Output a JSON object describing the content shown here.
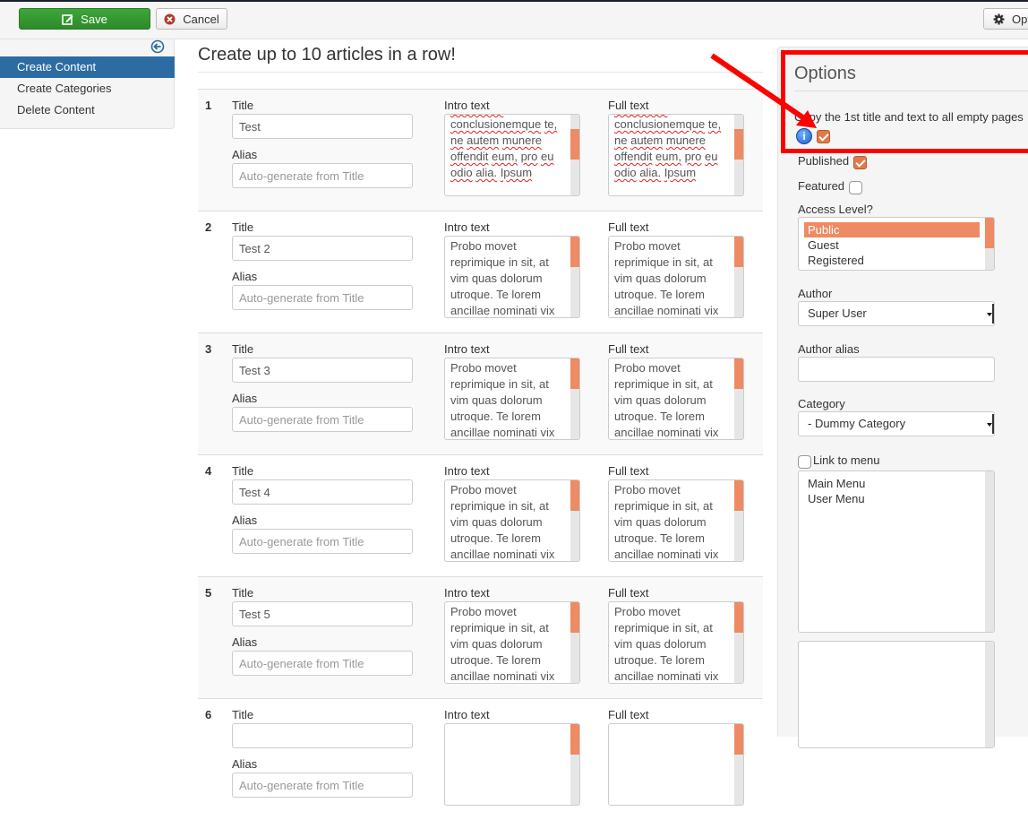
{
  "toolbar": {
    "save_label": "Save",
    "cancel_label": "Cancel",
    "options_label": "Options"
  },
  "sidebar": {
    "items": [
      {
        "label": "Create Content",
        "active": true
      },
      {
        "label": "Create Categories",
        "active": false
      },
      {
        "label": "Delete Content",
        "active": false
      }
    ]
  },
  "main": {
    "title": "Create up to 10 articles in a row!",
    "labels": {
      "title": "Title",
      "alias": "Alias",
      "intro": "Intro text",
      "full": "Full text",
      "alias_placeholder": "Auto-generate from Title"
    },
    "articles": [
      {
        "num": "1",
        "title": "Test",
        "intro": "definiebas conclusionemque te, ne autem munere offendit eum, pro eu odio alia. Ipsum",
        "full": "definiebas conclusionemque te, ne autem munere offendit eum, pro eu odio alia. Ipsum"
      },
      {
        "num": "2",
        "title": "Test 2",
        "intro": "Probo movet reprimique in sit, at vim quas dolorum utroque. Te lorem ancillae nominati vix",
        "full": "Probo movet reprimique in sit, at vim quas dolorum utroque. Te lorem ancillae nominati vix"
      },
      {
        "num": "3",
        "title": "Test 3",
        "intro": "Probo movet reprimique in sit, at vim quas dolorum utroque. Te lorem ancillae nominati vix",
        "full": "Probo movet reprimique in sit, at vim quas dolorum utroque. Te lorem ancillae nominati vix"
      },
      {
        "num": "4",
        "title": "Test 4",
        "intro": "Probo movet reprimique in sit, at vim quas dolorum utroque. Te lorem ancillae nominati vix",
        "full": "Probo movet reprimique in sit, at vim quas dolorum utroque. Te lorem ancillae nominati vix"
      },
      {
        "num": "5",
        "title": "Test 5",
        "intro": "Probo movet reprimique in sit, at vim quas dolorum utroque. Te lorem ancillae nominati vix",
        "full": "Probo movet reprimique in sit, at vim quas dolorum utroque. Te lorem ancillae nominati vix"
      },
      {
        "num": "6",
        "title": "",
        "intro": "",
        "full": ""
      }
    ]
  },
  "options": {
    "title": "Options",
    "copy_label": "Copy the 1st title and text to all empty pages",
    "copy_checked": true,
    "published_label": "Published",
    "published_checked": true,
    "featured_label": "Featured",
    "featured_checked": false,
    "access_label": "Access Level?",
    "access_options": [
      "Public",
      "Guest",
      "Registered"
    ],
    "access_selected": "Public",
    "author_label": "Author",
    "author_value": "Super User",
    "author_alias_label": "Author alias",
    "author_alias_value": "",
    "category_label": "Category",
    "category_value": "- Dummy Category",
    "link_menu_label": "Link to menu",
    "link_menu_checked": false,
    "menu_options": [
      "Main Menu",
      "User Menu"
    ]
  },
  "colors": {
    "accent": "#2d6ca2",
    "save_green": "#2d8a2a",
    "highlight_red": "#ff0000",
    "checkbox_orange": "#e07a4a",
    "selection_orange": "#ee8a64"
  }
}
